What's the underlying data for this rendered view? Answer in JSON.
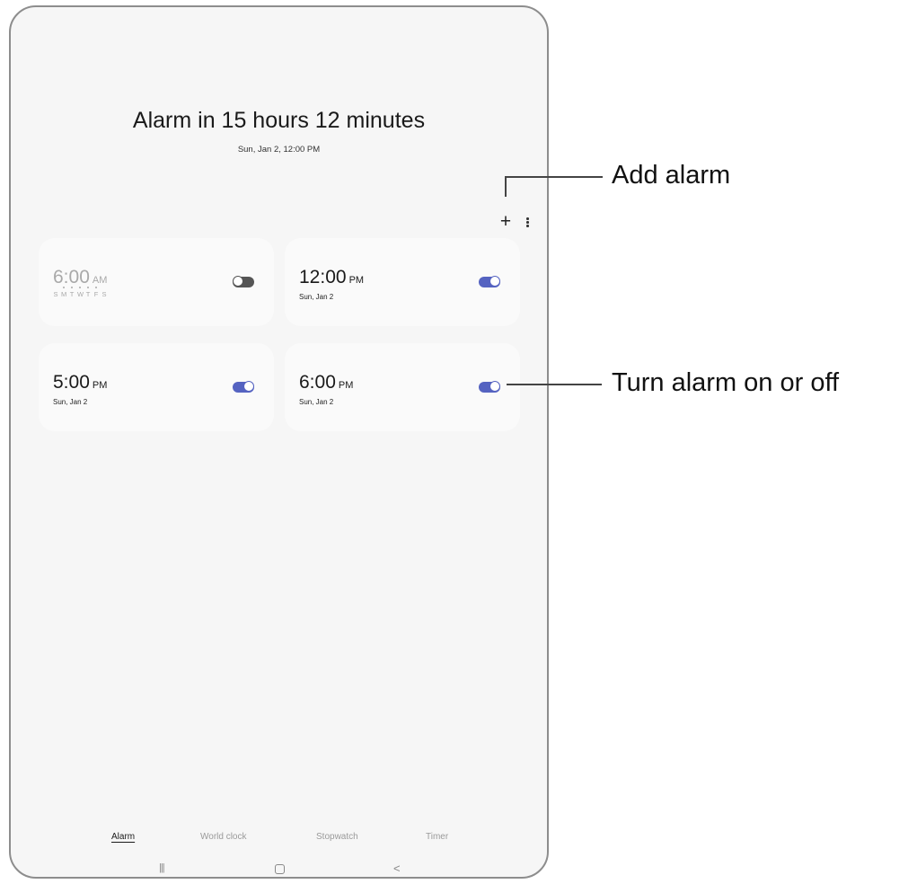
{
  "header": {
    "title": "Alarm in 15 hours 12 minutes",
    "subtitle": "Sun, Jan 2, 12:00 PM"
  },
  "toolbar": {
    "add_icon": "plus-icon",
    "add_glyph": "+",
    "more_icon": "more-vertical-icon"
  },
  "alarms": [
    {
      "time": "6:00",
      "ampm": "AM",
      "sub": "",
      "days": [
        "S",
        "M",
        "T",
        "W",
        "T",
        "F",
        "S"
      ],
      "enabled": false
    },
    {
      "time": "12:00",
      "ampm": "PM",
      "sub": "Sun, Jan 2",
      "enabled": true
    },
    {
      "time": "5:00",
      "ampm": "PM",
      "sub": "Sun, Jan 2",
      "enabled": true
    },
    {
      "time": "6:00",
      "ampm": "PM",
      "sub": "Sun, Jan 2",
      "enabled": true
    }
  ],
  "tabs": [
    {
      "label": "Alarm",
      "active": true
    },
    {
      "label": "World clock",
      "active": false
    },
    {
      "label": "Stopwatch",
      "active": false
    },
    {
      "label": "Timer",
      "active": false
    }
  ],
  "navbar": {
    "recent_glyph": "|||",
    "back_glyph": "<"
  },
  "annotations": {
    "add_alarm": "Add alarm",
    "toggle": "Turn alarm on or off"
  },
  "colors": {
    "accent": "#5563c1",
    "toggle_off": "#555555",
    "background": "#f6f6f6",
    "card": "#fafafa"
  }
}
